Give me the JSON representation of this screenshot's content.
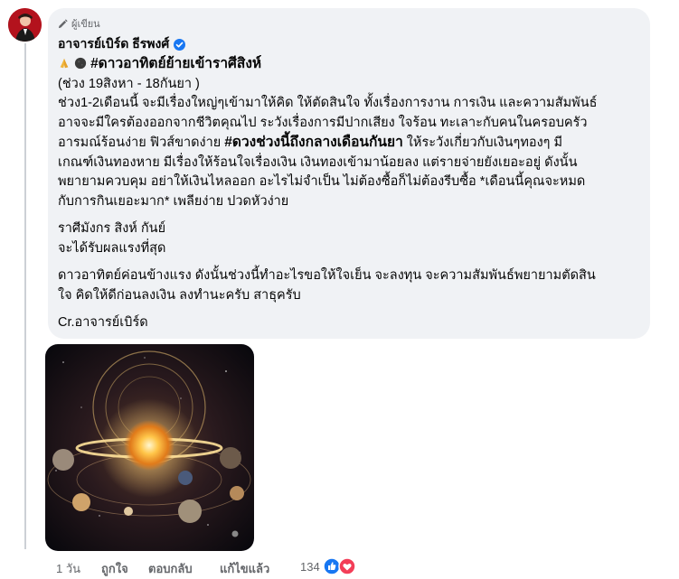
{
  "comment": {
    "badge_label": "ผู้เขียน",
    "author_name": "อาจารย์เบิร์ด ธีรพงศ์",
    "headline_hashtag": "#ดาวอาทิตย์ย้ายเข้าราศีสิงห์",
    "period": "(ช่วง 19สิงหา - 18กันยา )",
    "paragraph1_lines": [
      "ช่วง1-2เดือนนี้ จะมีเรื่องใหญ่ๆเข้ามาให้คิด ให้ตัดสินใจ ทั้งเรื่องการงาน การเงิน และความสัมพันธ์",
      "อาจจะมีใครต้องออกจากชีวิตคุณไป ระวังเรื่องการมีปากเสียง ใจร้อน ทะเลาะกับคนในครอบครัว"
    ],
    "paragraph1_line3_before": "อารมณ์ร้อนง่าย ฟิวส์ขาดง่าย ",
    "paragraph1_line3_hashtag": "#ดวงช่วงนี้ถึงกลางเดือนกันยา",
    "paragraph1_line3_after": " ให้ระวังเกี่ยวกับเงินๆทองๆ มี",
    "paragraph1_rest_lines": [
      "เกณฑ์เงินทองหาย มีเรื่องให้ร้อนใจเรื่องเงิน เงินทองเข้ามาน้อยลง แต่รายจ่ายยังเยอะอยู่ ดังนั้น",
      "พยายามควบคุม อย่าให้เงินไหลออก อะไรไม่จำเป็น ไม่ต้องซื้อก็ไม่ต้องรีบซื้อ *เดือนนี้คุณจะหมด",
      "กับการกินเยอะมาก* เพลียง่าย ปวดหัวง่าย"
    ],
    "signs_line": "ราศีมังกร สิงห์ กันย์",
    "signs_effect": "จะได้รับผลแรงที่สุด",
    "paragraph3_lines": [
      "ดาวอาทิตย์ค่อนข้างแรง ดังนั้นช่วงนี้ทำอะไรขอให้ใจเย็น จะลงทุน จะความสัมพันธ์พยายามตัดสิน",
      "ใจ คิดให้ดีก่อนลงเงิน ลงทำนะครับ สาธุครับ"
    ],
    "credit": "Cr.อาจารย์เบิร์ด"
  },
  "actions": {
    "time": "1 วัน",
    "like": "ถูกใจ",
    "reply": "ตอบกลับ",
    "edited": "แก้ไขแล้ว",
    "reaction_count": "134"
  },
  "icons": [
    "pencil-icon",
    "verified-badge-icon",
    "pray-emoji-icon",
    "new-moon-emoji-icon",
    "like-reaction-icon",
    "love-reaction-icon"
  ],
  "colors": {
    "bubble": "#f0f2f5",
    "verified": "#1877f2",
    "like": "#1877f2",
    "love": "#f33e58",
    "meta": "#65676b"
  }
}
